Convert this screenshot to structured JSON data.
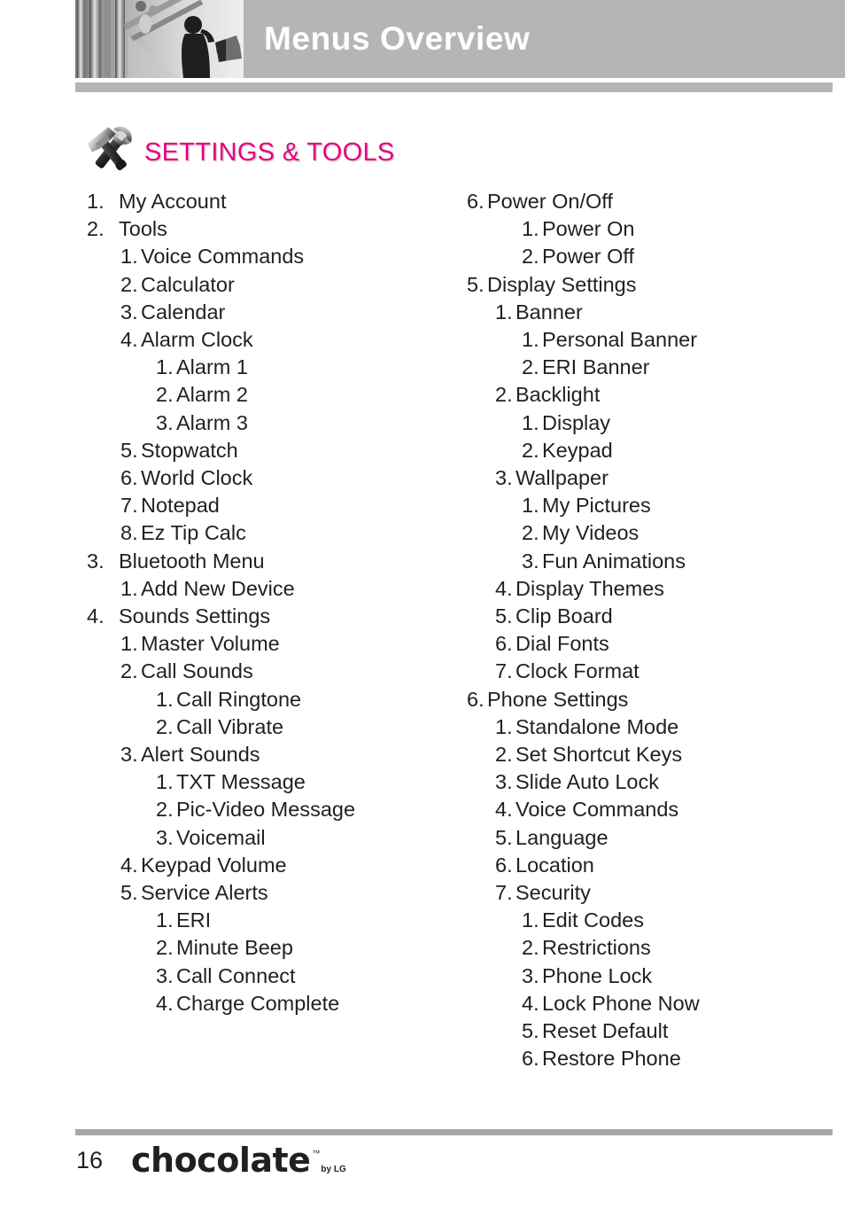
{
  "header": {
    "title": "Menus Overview",
    "photo_alt": "lifestyle-photo",
    "bar_color": "#b5b5b5"
  },
  "section": {
    "title": "SETTINGS & TOOLS",
    "title_color": "#e6007e",
    "icon": "wrench-hammer-icon"
  },
  "menu": {
    "left_column": [
      {
        "level": 1,
        "num": "1.",
        "label": "My Account"
      },
      {
        "level": 1,
        "num": "2.",
        "label": "Tools"
      },
      {
        "level": 2,
        "num": "1.",
        "label": "Voice Commands"
      },
      {
        "level": 2,
        "num": "2.",
        "label": "Calculator"
      },
      {
        "level": 2,
        "num": "3.",
        "label": "Calendar"
      },
      {
        "level": 2,
        "num": "4.",
        "label": "Alarm Clock"
      },
      {
        "level": 3,
        "num": "1.",
        "label": "Alarm 1"
      },
      {
        "level": 3,
        "num": "2.",
        "label": "Alarm 2"
      },
      {
        "level": 3,
        "num": "3.",
        "label": "Alarm 3"
      },
      {
        "level": 2,
        "num": "5.",
        "label": "Stopwatch"
      },
      {
        "level": 2,
        "num": "6.",
        "label": "World Clock"
      },
      {
        "level": 2,
        "num": "7.",
        "label": "Notepad"
      },
      {
        "level": 2,
        "num": "8.",
        "label": "Ez Tip Calc"
      },
      {
        "level": 1,
        "num": "3.",
        "label": "Bluetooth Menu"
      },
      {
        "level": 2,
        "num": "1.",
        "label": "Add New Device"
      },
      {
        "level": 1,
        "num": "4.",
        "label": "Sounds Settings"
      },
      {
        "level": 2,
        "num": "1.",
        "label": "Master Volume"
      },
      {
        "level": 2,
        "num": "2.",
        "label": "Call Sounds"
      },
      {
        "level": 3,
        "num": "1.",
        "label": "Call Ringtone"
      },
      {
        "level": 3,
        "num": "2.",
        "label": "Call Vibrate"
      },
      {
        "level": 2,
        "num": "3.",
        "label": "Alert Sounds"
      },
      {
        "level": 3,
        "num": "1.",
        "label": "TXT Message"
      },
      {
        "level": 3,
        "num": "2.",
        "label": "Pic-Video Message"
      },
      {
        "level": 3,
        "num": "3.",
        "label": "Voicemail"
      },
      {
        "level": 2,
        "num": "4.",
        "label": "Keypad Volume"
      },
      {
        "level": 2,
        "num": "5.",
        "label": "Service Alerts"
      },
      {
        "level": 3,
        "num": "1.",
        "label": "ERI"
      },
      {
        "level": 3,
        "num": "2.",
        "label": "Minute Beep"
      },
      {
        "level": 3,
        "num": "3.",
        "label": "Call Connect"
      },
      {
        "level": 3,
        "num": "4.",
        "label": "Charge Complete"
      }
    ],
    "right_column": [
      {
        "level": 1,
        "num": "6.",
        "label": "Power On/Off"
      },
      {
        "level": 3,
        "num": "1.",
        "label": "Power On"
      },
      {
        "level": 3,
        "num": "2.",
        "label": "Power Off"
      },
      {
        "level": 1,
        "num": "5.",
        "label": "Display Settings"
      },
      {
        "level": 2,
        "num": "1.",
        "label": "Banner"
      },
      {
        "level": 3,
        "num": "1.",
        "label": "Personal Banner"
      },
      {
        "level": 3,
        "num": "2.",
        "label": "ERI Banner"
      },
      {
        "level": 2,
        "num": "2.",
        "label": "Backlight"
      },
      {
        "level": 3,
        "num": "1.",
        "label": "Display"
      },
      {
        "level": 3,
        "num": "2.",
        "label": "Keypad"
      },
      {
        "level": 2,
        "num": "3.",
        "label": "Wallpaper"
      },
      {
        "level": 3,
        "num": "1.",
        "label": "My Pictures"
      },
      {
        "level": 3,
        "num": "2.",
        "label": "My Videos"
      },
      {
        "level": 3,
        "num": "3.",
        "label": "Fun Animations"
      },
      {
        "level": 2,
        "num": "4.",
        "label": "Display Themes"
      },
      {
        "level": 2,
        "num": "5.",
        "label": "Clip Board"
      },
      {
        "level": 2,
        "num": "6.",
        "label": "Dial Fonts"
      },
      {
        "level": 2,
        "num": "7.",
        "label": "Clock Format"
      },
      {
        "level": 1,
        "num": "6.",
        "label": "Phone Settings"
      },
      {
        "level": 2,
        "num": "1.",
        "label": "Standalone Mode"
      },
      {
        "level": 2,
        "num": "2.",
        "label": "Set Shortcut Keys"
      },
      {
        "level": 2,
        "num": "3.",
        "label": "Slide Auto Lock"
      },
      {
        "level": 2,
        "num": "4.",
        "label": "Voice Commands"
      },
      {
        "level": 2,
        "num": "5.",
        "label": "Language"
      },
      {
        "level": 2,
        "num": "6.",
        "label": "Location"
      },
      {
        "level": 2,
        "num": "7.",
        "label": "Security"
      },
      {
        "level": 3,
        "num": "1.",
        "label": "Edit Codes"
      },
      {
        "level": 3,
        "num": "2.",
        "label": "Restrictions"
      },
      {
        "level": 3,
        "num": "3.",
        "label": "Phone Lock"
      },
      {
        "level": 3,
        "num": "4.",
        "label": "Lock Phone Now"
      },
      {
        "level": 3,
        "num": "5.",
        "label": "Reset Default"
      },
      {
        "level": 3,
        "num": "6.",
        "label": "Restore Phone"
      }
    ]
  },
  "footer": {
    "page_number": "16",
    "brand_word": "chocolate",
    "brand_tm": "™",
    "brand_by": "by LG"
  }
}
